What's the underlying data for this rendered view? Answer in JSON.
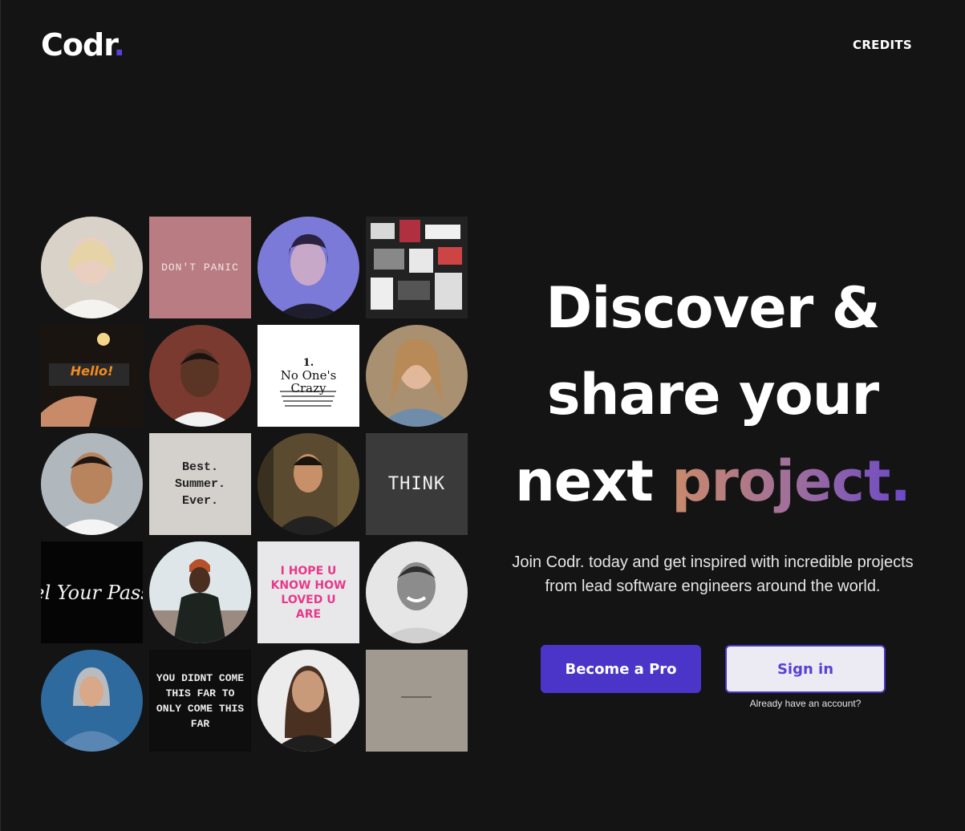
{
  "brand": {
    "name": "Codr",
    "dot": ".",
    "accent_color": "#5b3fd6"
  },
  "nav": {
    "credits_label": "CREDITS"
  },
  "hero": {
    "line1": "Discover &",
    "line2": "share your",
    "line3_plain": "next ",
    "line3_accent": "project.",
    "subtitle": "Join Codr. today and get inspired with incredible projects from lead software engineers around the world."
  },
  "actions": {
    "primary_label": "Become a Pro",
    "secondary_label": "Sign in",
    "secondary_hint": "Already have an account?"
  },
  "tiles": {
    "t2": "DON'T PANIC",
    "t6": "Hello!",
    "t8_num": "1.",
    "t8_title": "No One's Crazy",
    "t10": "Best. Summer. Ever.",
    "t12": "THINK",
    "t13": "el Your Pass",
    "t15": "I HOPE U KNOW HOW LOVED U ARE",
    "t18": "YOU DIDNT COME THIS FAR TO ONLY COME THIS FAR"
  },
  "colors": {
    "background": "#141414",
    "primary_button": "#4b35c9",
    "secondary_button": "#ecebf3"
  }
}
